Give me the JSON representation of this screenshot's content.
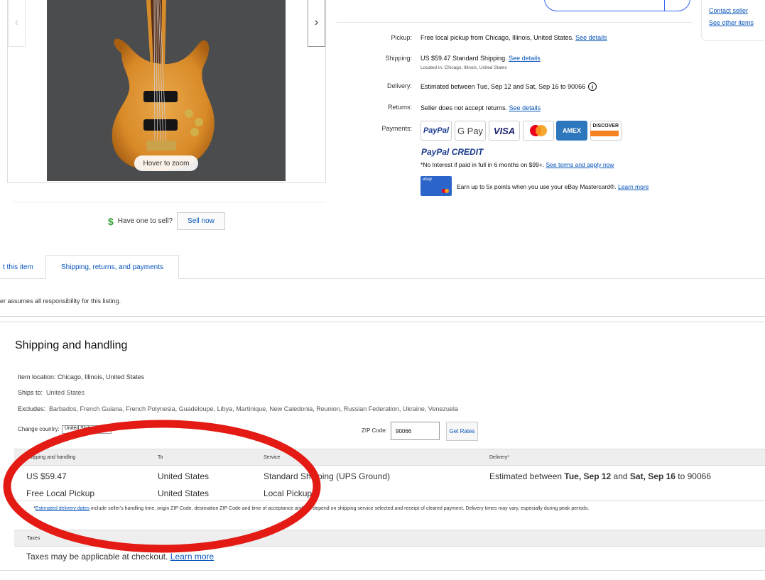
{
  "gallery": {
    "zoom_label": "Hover to zoom",
    "prev_icon": "chevron-left-icon",
    "next_icon": "chevron-right-icon"
  },
  "sell": {
    "prompt": "Have one to sell?",
    "button": "Sell now",
    "icon": "dollar-icon"
  },
  "seller": {
    "contact": "Contact seller",
    "other_items": "See other items"
  },
  "info": {
    "pickup": {
      "label": "Pickup:",
      "value": "Free local pickup from Chicago, Illinois, United States.",
      "link": "See details"
    },
    "shipping": {
      "label": "Shipping:",
      "value": "US $59.47 Standard Shipping.",
      "link": "See details",
      "sub": "Located in: Chicago, Illinois, United States"
    },
    "delivery": {
      "label": "Delivery:",
      "value": "Estimated between Tue, Sep 12 and Sat, Sep 16 to 90066"
    },
    "returns": {
      "label": "Returns:",
      "value": "Seller does not accept returns.",
      "link": "See details"
    },
    "payments": {
      "label": "Payments:"
    }
  },
  "payment_logos": [
    "PayPal",
    "G Pay",
    "VISA",
    "Mastercard",
    "AMEX",
    "DISCOVER"
  ],
  "paypal_credit": {
    "brand": "PayPal CREDIT",
    "text": "*No Interest if paid in full in 6 months on $99+.",
    "link": "See terms and apply now"
  },
  "mastercard_offer": {
    "card_label": "ebay",
    "text": "Earn up to 5x points when you use your eBay Mastercard®.",
    "link": "Learn more"
  },
  "tabs": [
    {
      "label": "t this item"
    },
    {
      "label": "Shipping, returns, and payments"
    }
  ],
  "notice": "er assumes all responsibility for this listing.",
  "shipping_section": {
    "title": "Shipping and handling",
    "item_location": "Item location: Chicago, Illinois, United States",
    "ships_to_label": "Ships to:",
    "ships_to_value": "United States",
    "excludes_label": "Excludes:",
    "excludes_value": "Barbados, French Guiana, French Polynesia, Guadeloupe, Libya, Martinique, New Caledonia, Reunion, Russian Federation, Ukraine, Venezuela",
    "change_country_label": "Change country:",
    "country_value": "United States",
    "zip_label": "ZIP Code:",
    "zip_value": "90066",
    "get_rates": "Get Rates"
  },
  "shipping_table": {
    "headers": [
      "Shipping and handling",
      "To",
      "Service",
      "Delivery*"
    ],
    "rows": [
      {
        "cost": "US $59.47",
        "to": "United States",
        "service": "Standard Shipping (UPS Ground)",
        "delivery_prefix": "Estimated between ",
        "delivery_start": "Tue, Sep 12",
        "delivery_and": " and ",
        "delivery_end": "Sat, Sep 16",
        "delivery_suffix": " to 90066"
      },
      {
        "cost": "Free Local Pickup",
        "to": "United States",
        "service": "Local Pickup"
      }
    ],
    "footnote_link": "Estimated delivery dates",
    "footnote_text": " include seller's handling time, origin ZIP Code, destination ZIP Code and time of acceptance and will depend on shipping service selected and receipt of cleared payment. Delivery times may vary, especially during peak periods."
  },
  "taxes": {
    "header": "Taxes",
    "text": "Taxes may be applicable at checkout.",
    "link": "Learn more"
  },
  "colors": {
    "link": "#0654ba",
    "annotation": "#e31b14"
  }
}
